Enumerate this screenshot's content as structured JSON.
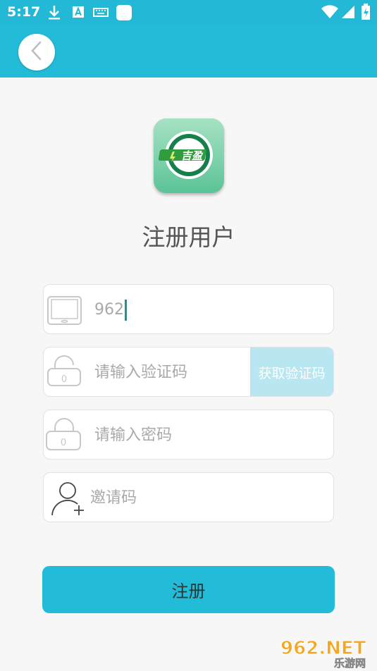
{
  "status_bar": {
    "time": "5:17"
  },
  "header": {
    "back_icon": "chevron-left-icon"
  },
  "logo": {
    "text": "吉盈"
  },
  "page": {
    "title": "注册用户"
  },
  "form": {
    "phone_value": "962",
    "code_placeholder": "请输入验证码",
    "get_code_label": "获取验证码",
    "password_placeholder": "请输入密码",
    "invite_placeholder": "邀请码"
  },
  "actions": {
    "register_label": "注册"
  },
  "watermark": {
    "site": "962.NET",
    "name": "乐游网"
  },
  "colors": {
    "accent": "#23bcd8",
    "get_code_bg": "#b8e6f1",
    "caret": "#0e9d8f"
  }
}
